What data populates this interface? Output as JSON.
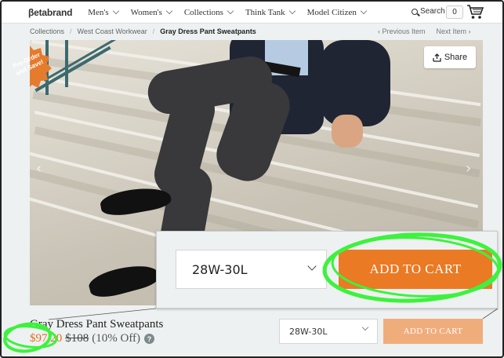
{
  "nav": {
    "logo": "βetabrand",
    "menu": [
      {
        "label": "Men's"
      },
      {
        "label": "Women's"
      },
      {
        "label": "Collections"
      },
      {
        "label": "Think Tank"
      },
      {
        "label": "Model Citizen"
      }
    ],
    "search_label": "Search",
    "cart_count": "0",
    "cart_icon": "shopping-cart-icon"
  },
  "breadcrumb": {
    "items": [
      "Collections",
      "West Coast Workwear",
      "Gray Dress Pant Sweatpants"
    ],
    "separator": "/",
    "previous": "‹ Previous Item",
    "next": "Next Item ›"
  },
  "hero": {
    "badge_line1": "Pre-Order",
    "badge_line2": "and Save!",
    "share_label": "Share",
    "prev_arrow": "‹",
    "next_arrow": "›"
  },
  "callout": {
    "size_value": "28W-30L",
    "add_to_cart": "ADD TO CART"
  },
  "product": {
    "title": "Gray Dress Pant Sweatpants",
    "price": "$97.20",
    "old_price": "$108",
    "discount": "(10% Off)",
    "help": "?",
    "size_value": "28W-30L",
    "add_to_cart": "ADD TO CART"
  },
  "colors": {
    "accent_orange": "#ea7a24",
    "accent_orange_light": "#f0ad7c",
    "annotation_green": "#3df23d"
  }
}
